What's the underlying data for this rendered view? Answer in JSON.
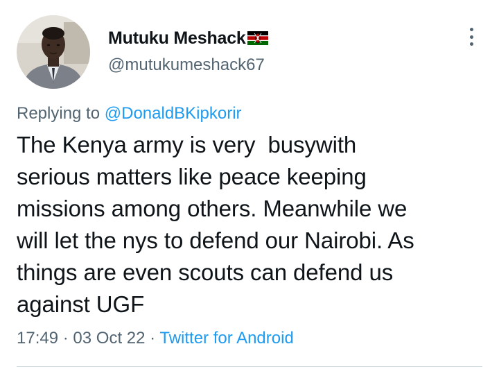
{
  "author": {
    "display_name": "Mutuku Meshack",
    "handle": "@mutukumeshack67",
    "flag_icon": "kenya-flag-icon",
    "avatar_icon": "profile-photo"
  },
  "reply": {
    "prefix": "Replying to",
    "mention": "@DonaldBKipkorir"
  },
  "tweet": {
    "text": "The Kenya army is very  busywith\nserious matters like peace keeping\nmissions among others. Meanwhile we\nwill let the nys to defend our Nairobi. As\nthings are even scouts can defend us\nagainst UGF"
  },
  "meta": {
    "time": "17:49",
    "separator1": "·",
    "date": "03 Oct 22",
    "separator2": "·",
    "source": "Twitter for Android"
  },
  "colors": {
    "text": "#0f1419",
    "secondary": "#536471",
    "link": "#1d9bf0",
    "divider": "#cfd9de"
  },
  "icons": {
    "more": "more-vertical-icon"
  }
}
